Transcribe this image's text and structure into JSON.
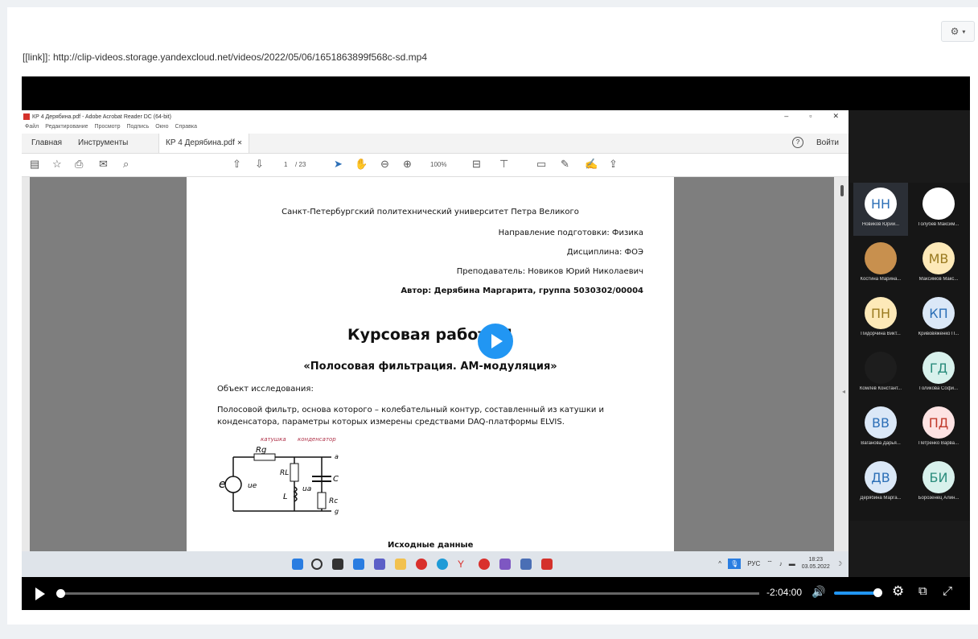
{
  "link": {
    "text": "[[link]]: http://clip-videos.storage.yandexcloud.net/videos/2022/05/06/1651863899f568c-sd.mp4"
  },
  "acrobat": {
    "window_title": "КР 4 Дерябина.pdf - Adobe Acrobat Reader DC (64-bit)",
    "menu": [
      "Файл",
      "Редактирование",
      "Просмотр",
      "Подпись",
      "Окно",
      "Справка"
    ],
    "tabs": {
      "home": "Главная",
      "tools": "Инструменты",
      "file": "КР 4 Дерябина.pdf"
    },
    "login": "Войти",
    "page_current": "1",
    "page_total": "/ 23",
    "zoom": "100%"
  },
  "document": {
    "university": "Санкт-Петербургский политехнический университет Петра Великого",
    "direction": "Направление подготовки: Физика",
    "discipline": "Дисциплина: ФОЭ",
    "teacher": "Преподаватель: Новиков Юрий Николаевич",
    "author": "Автор: Дерябина Маргарита, группа 5030302/00004",
    "title": "Курсовая работа 4",
    "subtitle": "«Полосовая фильтрация. АМ-модуляция»",
    "object_label": "Объект исследования:",
    "description": "Полосовой фильтр, основа которого – колебательный контур, составленный из катушки и конденсатора, параметры которых измерены средствами DAQ-платформы ELVIS.",
    "circuit_labels": {
      "coil": "катушка",
      "capacitor": "конденсатор",
      "rg": "Rg",
      "rl": "RL",
      "l": "L",
      "c": "C",
      "rc": "Rc",
      "e": "e",
      "ue": "ue",
      "ua": "ua",
      "a": "a",
      "g": "g"
    },
    "next_heading": "Исходные данные"
  },
  "taskbar": {
    "lang": "РУС",
    "time": "18:23",
    "date": "03.05.2022"
  },
  "participants": [
    {
      "initials": "НН",
      "name": "Новиков Юрий...",
      "bg": "#ffffff",
      "fg": "#2c6fb7",
      "active": true
    },
    {
      "initials": "",
      "name": "Голубев Максим...",
      "bg": "#ffffff",
      "fg": "#8a6b4e",
      "active": false
    },
    {
      "initials": "",
      "name": "Костина Марина...",
      "bg": "#c8904e",
      "fg": "#ffffff",
      "active": false
    },
    {
      "initials": "МВ",
      "name": "Максимов Макс...",
      "bg": "#fde9b8",
      "fg": "#9a7a1f",
      "active": false
    },
    {
      "initials": "ПН",
      "name": "Пидорчина Викт...",
      "bg": "#fde9b8",
      "fg": "#9a7a1f",
      "active": false
    },
    {
      "initials": "КП",
      "name": "Кривовяженко П...",
      "bg": "#dbe8f7",
      "fg": "#2c6fb7",
      "active": false
    },
    {
      "initials": "",
      "name": "Комлев Констант...",
      "bg": "#1d1d1d",
      "fg": "#ffffff",
      "active": false
    },
    {
      "initials": "ГД",
      "name": "Голикова Софи...",
      "bg": "#d8f1ec",
      "fg": "#2a8c7c",
      "active": false
    },
    {
      "initials": "ВВ",
      "name": "Ваганова Дарья...",
      "bg": "#dbe8f7",
      "fg": "#2c6fb7",
      "active": false
    },
    {
      "initials": "ПД",
      "name": "Петренко Варва...",
      "bg": "#fde3e3",
      "fg": "#c0392b",
      "active": false
    },
    {
      "initials": "ДВ",
      "name": "Дерябина Марга...",
      "bg": "#dbe8f7",
      "fg": "#2c6fb7",
      "active": false
    },
    {
      "initials": "БИ",
      "name": "Борозенец Алин...",
      "bg": "#d8f1ec",
      "fg": "#2a8c7c",
      "active": false
    }
  ],
  "player": {
    "time_remaining": "-2:04:00",
    "progress": 0.0,
    "volume": 1.0,
    "accent": "#2196f3"
  }
}
